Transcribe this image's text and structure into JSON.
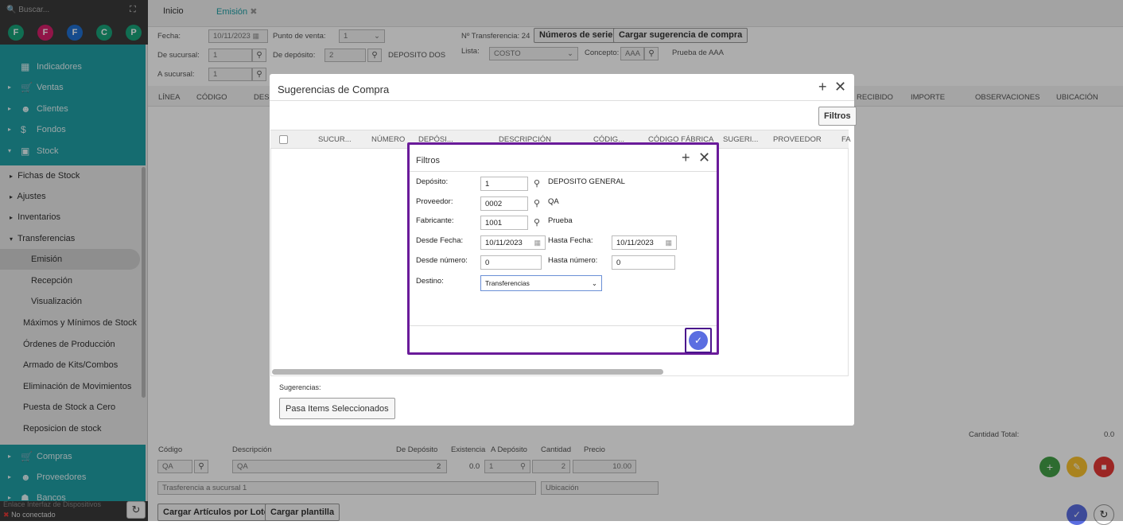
{
  "sidebar": {
    "search_placeholder": "Buscar...",
    "circles": [
      "F",
      "F",
      "F",
      "C",
      "P"
    ],
    "circle_colors": [
      "#19a37a",
      "#d61f6b",
      "#1f6fd0",
      "#19a37a",
      "#19a37a"
    ],
    "top_items": [
      {
        "label": "Indicadores",
        "icon": "chart-icon"
      },
      {
        "label": "Ventas",
        "icon": "cart-icon"
      },
      {
        "label": "Clientes",
        "icon": "users-icon"
      },
      {
        "label": "Fondos",
        "icon": "dollar-icon"
      },
      {
        "label": "Stock",
        "icon": "box-icon"
      }
    ],
    "stock_items": [
      "Fichas de Stock",
      "Ajustes",
      "Inventarios",
      "Transferencias"
    ],
    "transfer_items": [
      "Emisión",
      "Recepción",
      "Visualización"
    ],
    "more_items": [
      "Máximos y Mínimos de Stock",
      "Órdenes de Producción",
      "Armado de Kits/Combos",
      "Eliminación de Movimientos",
      "Puesta de Stock a Cero",
      "Reposicion de stock"
    ],
    "bottom_items": [
      {
        "label": "Compras",
        "icon": "basket-icon"
      },
      {
        "label": "Proveedores",
        "icon": "users-icon"
      },
      {
        "label": "Bancos",
        "icon": "bank-icon"
      }
    ],
    "device_link": "Enlace Interfaz de Dispositivos",
    "status": "No conectado"
  },
  "tabs": {
    "inicio": "Inicio",
    "emision": "Emisión"
  },
  "form": {
    "fecha_label": "Fecha:",
    "fecha": "10/11/2023",
    "punto_venta_label": "Punto de venta:",
    "punto_venta": "1",
    "transferencia": "Nº Transferencia: 24",
    "numeros_serie": "Números de serie",
    "cargar_sugerencia": "Cargar sugerencia de compra",
    "de_sucursal_label": "De sucursal:",
    "de_sucursal": "1",
    "de_deposito_label": "De depósito:",
    "de_deposito": "2",
    "de_deposito_name": "DEPOSITO DOS",
    "lista_label": "Lista:",
    "lista": "COSTO",
    "concepto_label": "Concepto:",
    "concepto": "AAA",
    "concepto_desc": "Prueba de AAA",
    "a_sucursal_label": "A sucursal:",
    "a_sucursal": "1"
  },
  "table_headers": [
    "LÍNEA",
    "CÓDIGO",
    "DESC",
    "RECIBIDO",
    "IMPORTE",
    "OBSERVACIONES",
    "UBICACIÓN"
  ],
  "bottom": {
    "cantidad_total_label": "Cantidad Total:",
    "cantidad_total": "0.0",
    "headers": [
      "Código",
      "Descripción",
      "De Depósito",
      "Existencia",
      "A Depósito",
      "Cantidad",
      "Precio"
    ],
    "codigo": "QA",
    "descripcion": "QA",
    "de_deposito": "2",
    "existencia": "0.0",
    "a_deposito": "1",
    "cantidad": "2",
    "precio": "10.00",
    "observacion": "Trasferencia a sucursal 1",
    "ubicacion_placeholder": "Ubicación",
    "cargar_lote": "Cargar Artículos por Lote",
    "cargar_plantilla": "Cargar plantilla"
  },
  "sugerencias_modal": {
    "title": "Sugerencias de Compra",
    "filtros_btn": "Filtros",
    "columns": [
      "SUCUR...",
      "NÚMERO",
      "DEPÓSI...",
      "DESCRIPCIÓN",
      "CÓDIG...",
      "CÓDIGO FÁBRICA",
      "SUGERI...",
      "PROVEEDOR",
      "FA"
    ],
    "sugerencias_label": "Sugerencias:",
    "pasa_btn": "Pasa Items Seleccionados"
  },
  "filtros_modal": {
    "title": "Filtros",
    "deposito_label": "Depósito:",
    "deposito": "1",
    "deposito_name": "DEPOSITO GENERAL",
    "proveedor_label": "Proveedor:",
    "proveedor": "0002",
    "proveedor_name": "QA",
    "fabricante_label": "Fabricante:",
    "fabricante": "1001",
    "fabricante_name": "Prueba",
    "desde_fecha_label": "Desde Fecha:",
    "desde_fecha": "10/11/2023",
    "hasta_fecha_label": "Hasta Fecha:",
    "hasta_fecha": "10/11/2023",
    "desde_numero_label": "Desde número:",
    "desde_numero": "0",
    "hasta_numero_label": "Hasta número:",
    "hasta_numero": "0",
    "destino_label": "Destino:",
    "destino": "Transferencias"
  }
}
